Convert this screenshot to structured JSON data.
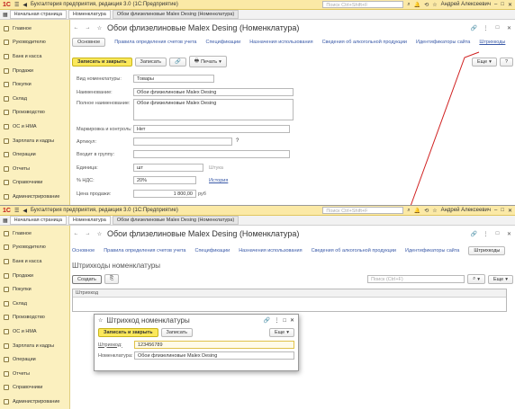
{
  "app": {
    "logo": "1С",
    "title": "Бухгалтерия предприятия, редакция 3.0",
    "title_suffix": "(1С:Предприятие)",
    "search_placeholder": "Поиск Ctrl+Shift+F",
    "user": "Андрей Алексеевич"
  },
  "tabs": [
    "Начальная страница",
    "Номенклатура",
    "Обои флизелиновые Malex Desing (Номенклатура)"
  ],
  "sidebar": [
    {
      "label": "Главное",
      "icon": "home-icon"
    },
    {
      "label": "Руководителю",
      "icon": "chart-icon"
    },
    {
      "label": "Банк и касса",
      "icon": "bank-icon"
    },
    {
      "label": "Продажи",
      "icon": "cart-icon"
    },
    {
      "label": "Покупки",
      "icon": "basket-icon"
    },
    {
      "label": "Склад",
      "icon": "warehouse-icon"
    },
    {
      "label": "Производство",
      "icon": "factory-icon"
    },
    {
      "label": "ОС и НМА",
      "icon": "assets-icon"
    },
    {
      "label": "Зарплата и кадры",
      "icon": "people-icon"
    },
    {
      "label": "Операции",
      "icon": "operations-icon"
    },
    {
      "label": "Отчеты",
      "icon": "reports-icon"
    },
    {
      "label": "Справочники",
      "icon": "book-icon"
    },
    {
      "label": "Администрирование",
      "icon": "gear-icon"
    }
  ],
  "top": {
    "heading": "Обои флизелиновые Malex Desing (Номенклатура)",
    "form_tabs": [
      "Основное",
      "Правила определения счетов учета",
      "Спецификации",
      "Назначения использования",
      "Сведения об алкогольной продукции",
      "Идентификаторы сайта",
      "Штрихкоды"
    ],
    "save_close": "Записать и закрыть",
    "save": "Записать",
    "print": "Печать",
    "more": "Еще",
    "help": "?",
    "fields": [
      {
        "label": "Вид номенклатуры:",
        "value": "Товары"
      },
      {
        "label": "Наименование:",
        "value": "Обои флизелиновые Malex Desing"
      },
      {
        "label": "Полное наименование:",
        "value": "Обои флизелиновые Malex Desing"
      },
      {
        "label": "Маркировка и контроль:",
        "value": "Нет"
      },
      {
        "label": "Артикул:",
        "value": ""
      },
      {
        "label": "Входит в группу:",
        "value": ""
      },
      {
        "label": "Единица:",
        "value": "шт"
      },
      {
        "label": "% НДС:",
        "value": "20%"
      },
      {
        "label": "Цена продажи:",
        "value": "1 800,00"
      }
    ],
    "unit_hint": "Штука",
    "history": "История",
    "currency": "руб"
  },
  "bottom": {
    "heading": "Обои флизелиновые Malex Desing (Номенклатура)",
    "active_tab": "Штрихкоды",
    "sub_heading": "Штрихкоды номенклатуры",
    "create": "Создать",
    "search_placeholder": "Поиск (Ctrl+F)",
    "more": "Еще",
    "col": "Штрихкод"
  },
  "dialog": {
    "title": "Штрихкод номенклатуры",
    "save_close": "Записать и закрыть",
    "save": "Записать",
    "more": "Еще",
    "barcode_label": "Штрихкод:",
    "barcode_value": "123456789",
    "item_label": "Номенклатура:",
    "item_value": "Обои флизелиновые Malex Desing"
  }
}
